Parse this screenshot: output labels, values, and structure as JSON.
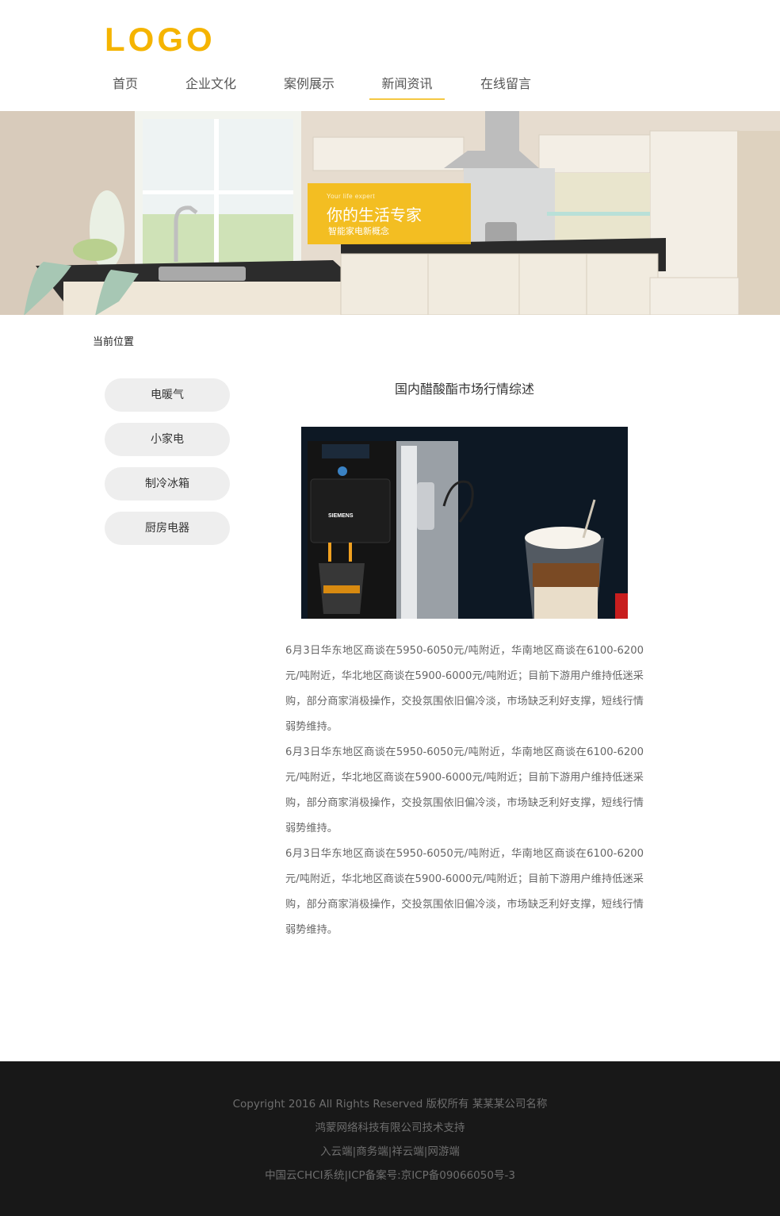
{
  "header": {
    "logo": "LOGO",
    "nav": [
      {
        "label": "首页",
        "active": false
      },
      {
        "label": "企业文化",
        "active": false
      },
      {
        "label": "案例展示",
        "active": false
      },
      {
        "label": "新闻资讯",
        "active": true
      },
      {
        "label": "在线留言",
        "active": false
      }
    ]
  },
  "banner": {
    "small_text": "Your life expert",
    "headline": "你的生活专家",
    "subline": "智能家电新概念",
    "overlay_color": "#f5b90a"
  },
  "breadcrumb": "当前位置",
  "sidebar": {
    "items": [
      {
        "label": "电暖气"
      },
      {
        "label": "小家电"
      },
      {
        "label": "制冷冰箱"
      },
      {
        "label": "厨房电器"
      }
    ]
  },
  "article": {
    "title": "国内醋酸酯市场行情综述",
    "image_brand_text": "SIEMENS",
    "paragraphs": [
      "6月3日华东地区商谈在5950-6050元/吨附近，华南地区商谈在6100-6200元/吨附近，华北地区商谈在5900-6000元/吨附近；目前下游用户维持低迷采购，部分商家消极操作，交投氛围依旧偏冷淡，市场缺乏利好支撑，短线行情弱势维持。",
      "6月3日华东地区商谈在5950-6050元/吨附近，华南地区商谈在6100-6200元/吨附近，华北地区商谈在5900-6000元/吨附近；目前下游用户维持低迷采购，部分商家消极操作，交投氛围依旧偏冷淡，市场缺乏利好支撑，短线行情弱势维持。",
      "6月3日华东地区商谈在5950-6050元/吨附近，华南地区商谈在6100-6200元/吨附近，华北地区商谈在5900-6000元/吨附近；目前下游用户维持低迷采购，部分商家消极操作，交投氛围依旧偏冷淡，市场缺乏利好支撑，短线行情弱势维持。"
    ]
  },
  "footer": {
    "copyright": "Copyright 2016 All Rights Reserved 版权所有 某某某公司名称",
    "support": "鸿蒙网络科技有限公司技术支持",
    "links": "入云端|商务端|祥云端|网游端",
    "icp": "中国云CHCI系统|ICP备案号:京ICP备09066050号-3"
  },
  "colors": {
    "accent": "#f5b400",
    "nav_underline": "#f5c842",
    "footer_bg": "#181818",
    "sidebar_bg": "#eeeeee"
  }
}
